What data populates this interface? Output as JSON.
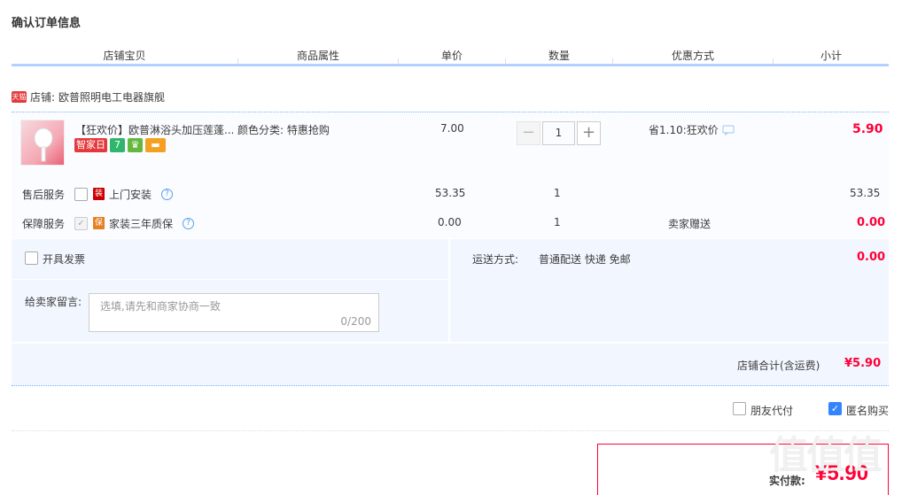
{
  "page_title": "确认订单信息",
  "columns": [
    "店铺宝贝",
    "商品属性",
    "单价",
    "数量",
    "优惠方式",
    "小计"
  ],
  "shop": {
    "badge": "天猫",
    "label": "店铺:",
    "name": "欧普照明电工电器旗舰"
  },
  "item": {
    "name": "【狂欢价】欧普淋浴头加压莲蓬...",
    "badges": [
      {
        "text": "智家日",
        "color": "#e4393c"
      },
      {
        "text": "7",
        "color": "#2fb66a"
      },
      {
        "text": "♛",
        "color": "#63b83d"
      },
      {
        "text": "▬",
        "color": "#f4a021"
      }
    ],
    "sku_label": "颜色分类:",
    "sku_value": "特惠抢购",
    "price": "7.00",
    "qty": "1",
    "minus": "−",
    "plus": "+",
    "promo": "省1.10:狂欢价",
    "subtotal": "5.90"
  },
  "services": [
    {
      "label": "售后服务",
      "icon_text": "装",
      "name": "上门安装",
      "price": "53.35",
      "qty": "1",
      "promo": "",
      "subtotal": "53.35",
      "checked": false,
      "disabled": false
    },
    {
      "label": "保障服务",
      "icon_text": "保",
      "name": "家装三年质保",
      "price": "0.00",
      "qty": "1",
      "promo": "卖家赠送",
      "subtotal": "0.00",
      "checked": true,
      "disabled": true
    }
  ],
  "invoice_label": "开具发票",
  "message": {
    "label": "给卖家留言:",
    "placeholder": "选填,请先和商家协商一致",
    "counter": "0/200"
  },
  "shipping": {
    "label": "运送方式:",
    "value": "普通配送 快递 免邮",
    "fee": "0.00"
  },
  "shop_total": {
    "label": "店铺合计(含运费)",
    "value": "¥5.90"
  },
  "options": {
    "friend_pay": "朋友代付",
    "anonymous": "匿名购买"
  },
  "pay": {
    "label": "实付款:",
    "amount": "¥5.90"
  },
  "watermark": "值值值",
  "colors": {
    "accent": "#ff0036",
    "header_line": "#b2d1ff",
    "block_bg": "#f2f7ff",
    "check_blue": "#3385ff"
  }
}
